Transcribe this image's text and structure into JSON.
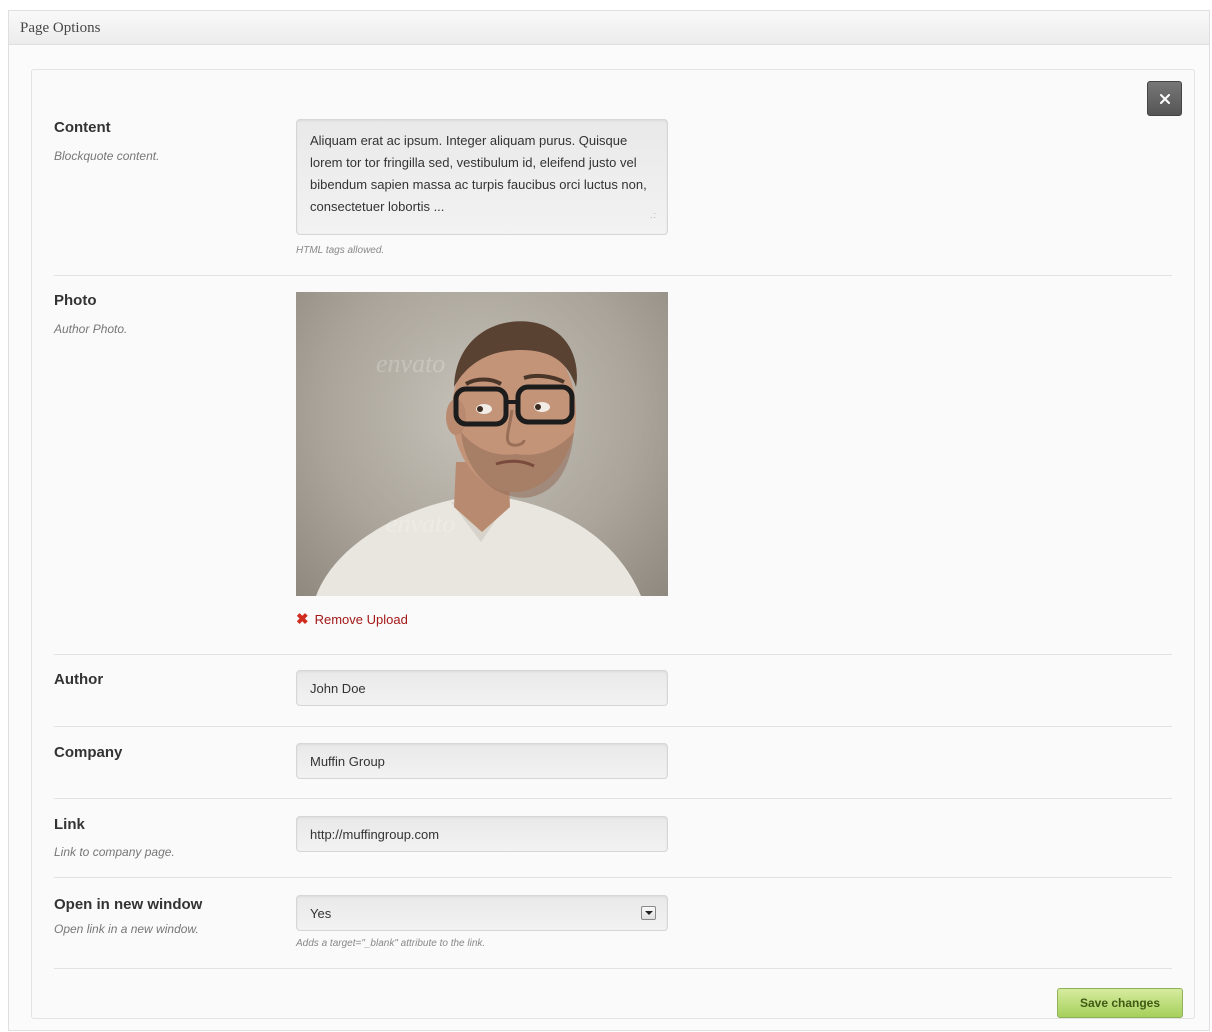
{
  "window": {
    "title": "Page Options"
  },
  "close_label": "×",
  "fields": {
    "content": {
      "label": "Content",
      "description": "Blockquote content.",
      "value": "Aliquam erat ac ipsum. Integer aliquam purus. Quisque lorem tor tor fringilla sed, vestibulum id, eleifend justo vel bibendum sapien massa ac turpis faucibus orci luctus non, consectetuer lobortis ...",
      "hint": "HTML tags allowed."
    },
    "photo": {
      "label": "Photo",
      "description": "Author Photo.",
      "remove_label": "Remove Upload"
    },
    "author": {
      "label": "Author",
      "value": "John Doe"
    },
    "company": {
      "label": "Company",
      "value": "Muffin Group"
    },
    "link": {
      "label": "Link",
      "description": "Link to company page.",
      "value": "http://muffingroup.com"
    },
    "new_window": {
      "label": "Open in new window",
      "description": "Open link in a new window.",
      "value": "Yes",
      "hint": "Adds a target=\"_blank\" attribute to the link."
    }
  },
  "save_label": "Save changes",
  "colors": {
    "save_button": "#a6cf5b",
    "remove_link": "#a31818",
    "close_button": "#555555"
  }
}
